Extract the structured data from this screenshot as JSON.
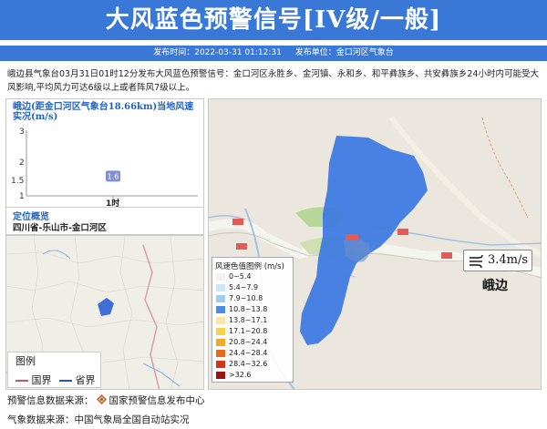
{
  "header": {
    "title": "大风蓝色预警信号[IV级/一般]",
    "publish_time_label": "发布时间：2022-03-31 01:12:31",
    "publish_unit_label": "发布单位：金口河区气象台"
  },
  "description": "峨边县气象台03月31日01时12分发布大风蓝色预警信号：金口河区永胜乡、金河镇、永和乡、和平彝族乡、共安彝族乡24小时内可能受大风影响,平均风力可达6级以上或者阵风7级以上。",
  "station_chart": {
    "title": "峨边(距金口河区气象台18.66km)当地风速实况(m/s)",
    "y_ticks": [
      "3",
      "2",
      "1.5",
      "1"
    ],
    "x_tick": "1时",
    "chart_data": {
      "type": "scatter",
      "title": "峨边(距金口河区气象台18.66km)当地风速实况(m/s)",
      "categories": [
        "1时"
      ],
      "values": [
        1.6
      ],
      "data_labels": [
        "1.6"
      ],
      "ylim": [
        1,
        3
      ]
    }
  },
  "location": {
    "title": "定位概览",
    "value": "四川省-乐山市-金口河区"
  },
  "mini_legend": {
    "title": "图例",
    "national_border": "国界",
    "provincial_border": "省界",
    "national_color": "#c2566e",
    "provincial_color": "#2052c8"
  },
  "wind_legend": {
    "title": "风速色值图例 (m/s)",
    "items": [
      {
        "label": "0~5.4",
        "color": "#f2f2f2"
      },
      {
        "label": "5.4~7.9",
        "color": "#cfe6f8"
      },
      {
        "label": "7.9~10.8",
        "color": "#9fcdf2"
      },
      {
        "label": "10.8~13.8",
        "color": "#4b8de6"
      },
      {
        "label": "13.8~17.1",
        "color": "#f8e7a2"
      },
      {
        "label": "17.1~20.8",
        "color": "#f6d24b"
      },
      {
        "label": "20.8~24.4",
        "color": "#f2a92b"
      },
      {
        "label": "24.4~28.4",
        "color": "#e86b1c"
      },
      {
        "label": "28.4~32.6",
        "color": "#d23418"
      },
      {
        "label": ">32.6",
        "color": "#9b1510"
      }
    ]
  },
  "map": {
    "wind_value": "3.4m/s",
    "place_name": "峨边",
    "warning_area_color": "#3f7be0"
  },
  "footer": {
    "warning_source": "预警信息数据来源：",
    "warning_source_name": "国家预警信息发布中心",
    "weather_source": "气象数据来源：中国气象局全国自动站实况"
  }
}
